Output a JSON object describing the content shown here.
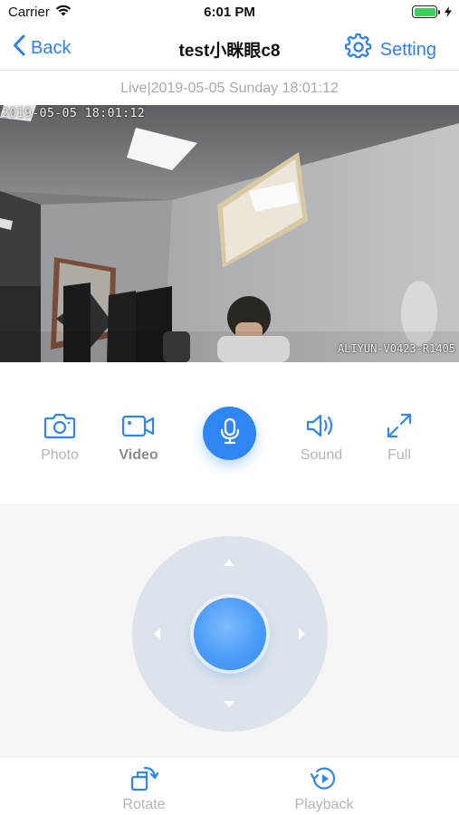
{
  "status_bar": {
    "carrier": "Carrier",
    "time": "6:01 PM"
  },
  "nav": {
    "back_label": "Back",
    "title": "test小眯眼c8",
    "setting_label": "Setting"
  },
  "live_info": "Live|2019-05-05 Sunday 18:01:12",
  "video": {
    "osd_timestamp": "2019-05-05 18:01:12",
    "osd_device_id": "ALIYUN-V0423-R1405"
  },
  "controls": {
    "photo_label": "Photo",
    "video_label": "Video",
    "sound_label": "Sound",
    "full_label": "Full"
  },
  "bottom_tabs": {
    "rotate_label": "Rotate",
    "playback_label": "Playback"
  },
  "colors": {
    "accent": "#2f86f2",
    "muted_label": "#b4b4b4",
    "ptz_ring": "#dde3ea",
    "battery": "#3ccf5a"
  },
  "icons": [
    "wifi-icon",
    "battery-icon",
    "chevron-left-icon",
    "gear-icon",
    "camera-icon",
    "video-camera-icon",
    "microphone-icon",
    "speaker-icon",
    "expand-icon",
    "rotate-icon",
    "playback-icon"
  ]
}
